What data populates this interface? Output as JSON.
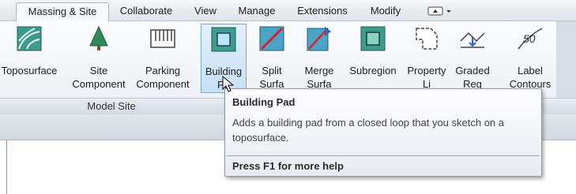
{
  "tabs": [
    {
      "label": "Massing & Site",
      "active": true
    },
    {
      "label": "Collaborate",
      "active": false
    },
    {
      "label": "View",
      "active": false
    },
    {
      "label": "Manage",
      "active": false
    },
    {
      "label": "Extensions",
      "active": false
    },
    {
      "label": "Modify",
      "active": false
    }
  ],
  "quick_access_icon": "toggle-dropdown-icon",
  "tools": [
    {
      "name": "toposurface",
      "icon": "toposurface-icon",
      "label_line1": "Toposurface",
      "label_line2": ""
    },
    {
      "name": "site-component",
      "icon": "tree-icon",
      "label_line1": "Site",
      "label_line2": "Component"
    },
    {
      "name": "parking-component",
      "icon": "parking-icon",
      "label_line1": "Parking",
      "label_line2": "Component"
    },
    {
      "name": "building-pad",
      "icon": "building-pad-icon",
      "label_line1": "Building",
      "label_line2": "Pa"
    },
    {
      "name": "split-surface",
      "icon": "split-surface-icon",
      "label_line1": "Split",
      "label_line2": "Surfa"
    },
    {
      "name": "merge-surfaces",
      "icon": "merge-surfaces-icon",
      "label_line1": "Merge",
      "label_line2": "Surfa"
    },
    {
      "name": "subregion",
      "icon": "subregion-icon",
      "label_line1": "Subregion",
      "label_line2": ""
    },
    {
      "name": "property-line",
      "icon": "property-line-icon",
      "label_line1": "Property",
      "label_line2": "Li"
    },
    {
      "name": "graded-region",
      "icon": "graded-region-icon",
      "label_line1": "Graded",
      "label_line2": "Reg"
    },
    {
      "name": "label-contours",
      "icon": "label-contours-icon",
      "label_line1": "Label",
      "label_line2": "Contours"
    }
  ],
  "panel_title": "Model Site",
  "tooltip": {
    "title": "Building Pad",
    "description": "Adds a building pad from a closed loop that you sketch on a toposurface.",
    "help": "Press F1 for more help"
  },
  "colors": {
    "accent": "#7ca9d6",
    "icon_green": "#2e8b57",
    "icon_teal": "#3a8f8a"
  }
}
